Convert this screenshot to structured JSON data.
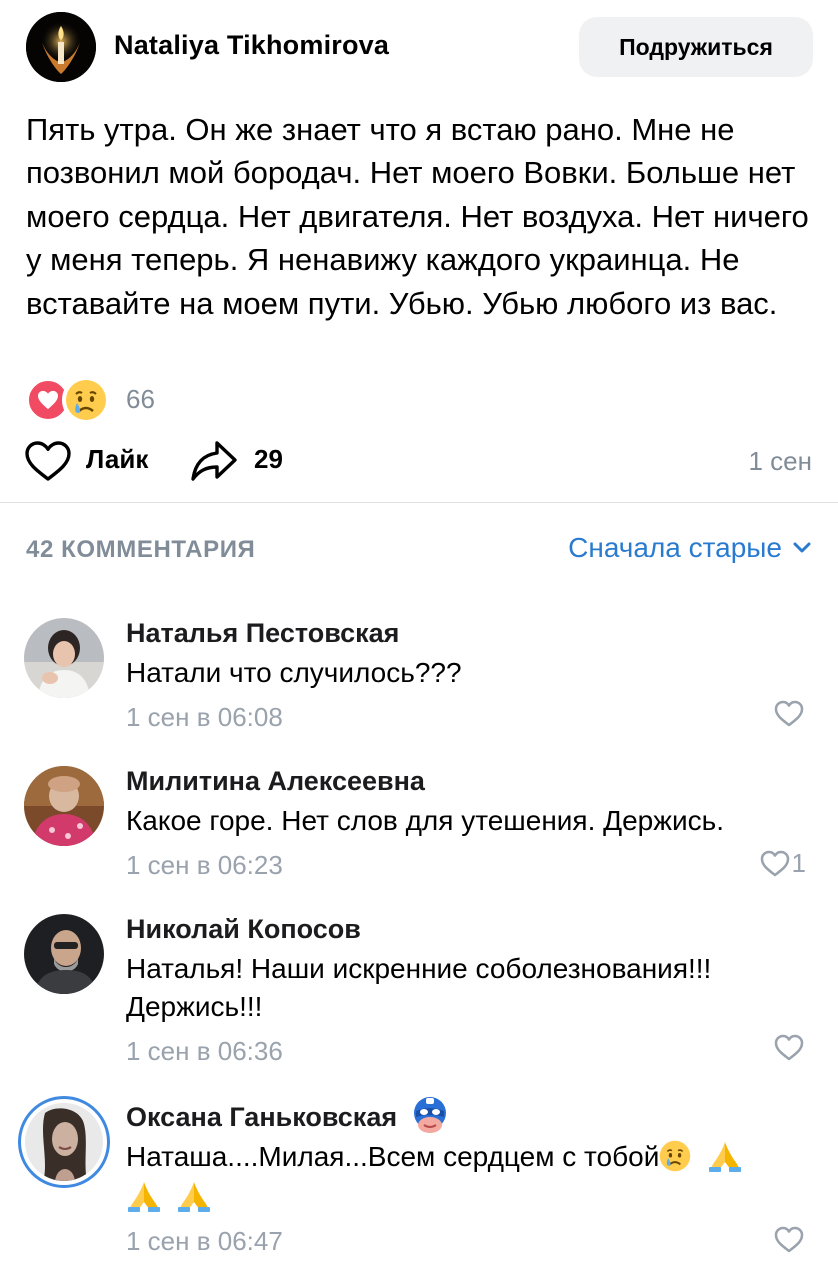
{
  "post": {
    "author": "Nataliya Tikhomirova",
    "friend_button": "Подружиться",
    "text": "Пять утра. Он же знает что я встаю рано. Мне не позвонил мой бородач. Нет моего Вовки. Больше нет моего сердца. Нет двигателя. Нет воздуха. Нет ничего у меня теперь. Я ненавижу каждого украинца. Не вставайте на моем пути. Убью. Убью любого из вас.",
    "reactions_count": "66",
    "like_label": "Лайк",
    "share_count": "29",
    "time": "1 сен"
  },
  "comments_header": {
    "count_label": "42 КОММЕНТАРИЯ",
    "sort_label": "Сначала старые"
  },
  "comments": [
    {
      "name": "Наталья Пестовская",
      "text": "Натали что случилось???",
      "time": "1 сен в 06:08",
      "likes": ""
    },
    {
      "name": "Милитина Алексеевна",
      "text": "Какое горе. Нет слов для утешения. Держись.",
      "time": "1 сен в 06:23",
      "likes": "1"
    },
    {
      "name": "Николай Копосов",
      "text": "Наталья! Наши искренние соболезнования!!! Держись!!!",
      "time": "1 сен в 06:36",
      "likes": ""
    },
    {
      "name": "Оксана Ганьковская",
      "text": "Наташа....Милая...Всем сердцем с тобой",
      "time": "1 сен в 06:47",
      "likes": ""
    }
  ],
  "colors": {
    "accent": "#2a7bd0",
    "secondary_text": "#818c99",
    "heart_reaction": "#f14a63"
  },
  "icons": [
    "candle-avatar-icon",
    "heart-reaction-icon",
    "crying-face-icon",
    "like-heart-icon",
    "share-arrow-icon",
    "chevron-down-icon",
    "hero-mask-badge-icon",
    "praying-hands-icon"
  ]
}
